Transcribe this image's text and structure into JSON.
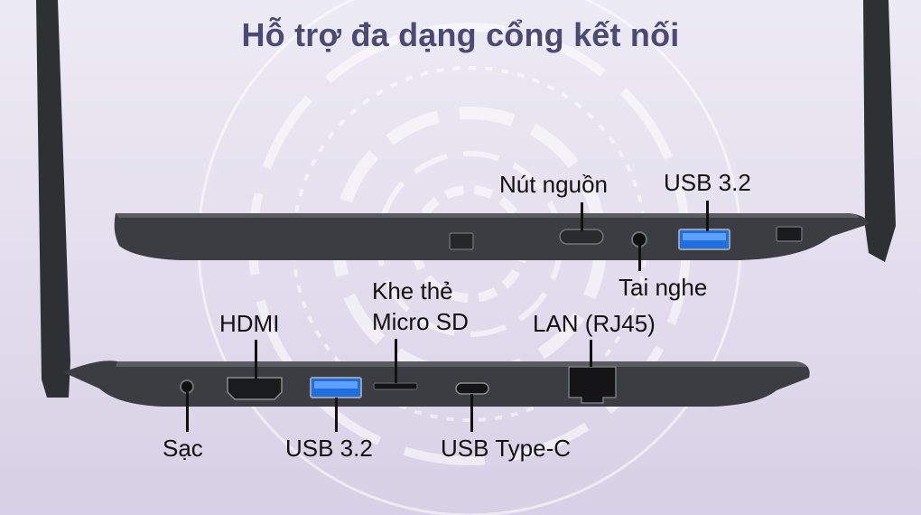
{
  "title": "Hỗ trợ đa dạng cổng kết nối",
  "top_ports": [
    {
      "name": "power-button",
      "label": "Nút nguồn"
    },
    {
      "name": "usb-3-2-right",
      "label": "USB 3.2"
    },
    {
      "name": "headphone-jack",
      "label": "Tai nghe"
    }
  ],
  "bottom_ports": [
    {
      "name": "hdmi-port",
      "label": "HDMI"
    },
    {
      "name": "microsd-slot",
      "label_line1": "Khe thẻ",
      "label_line2": "Micro SD"
    },
    {
      "name": "lan-port",
      "label": "LAN (RJ45)"
    },
    {
      "name": "charging-port",
      "label": "Sạc"
    },
    {
      "name": "usb-3-2-left",
      "label": "USB 3.2"
    },
    {
      "name": "usb-type-c-port",
      "label": "USB Type-C"
    }
  ],
  "colors": {
    "title": "#4a4a72",
    "usb_blue": "#1f6fe0",
    "chassis": "#3b3d42"
  }
}
